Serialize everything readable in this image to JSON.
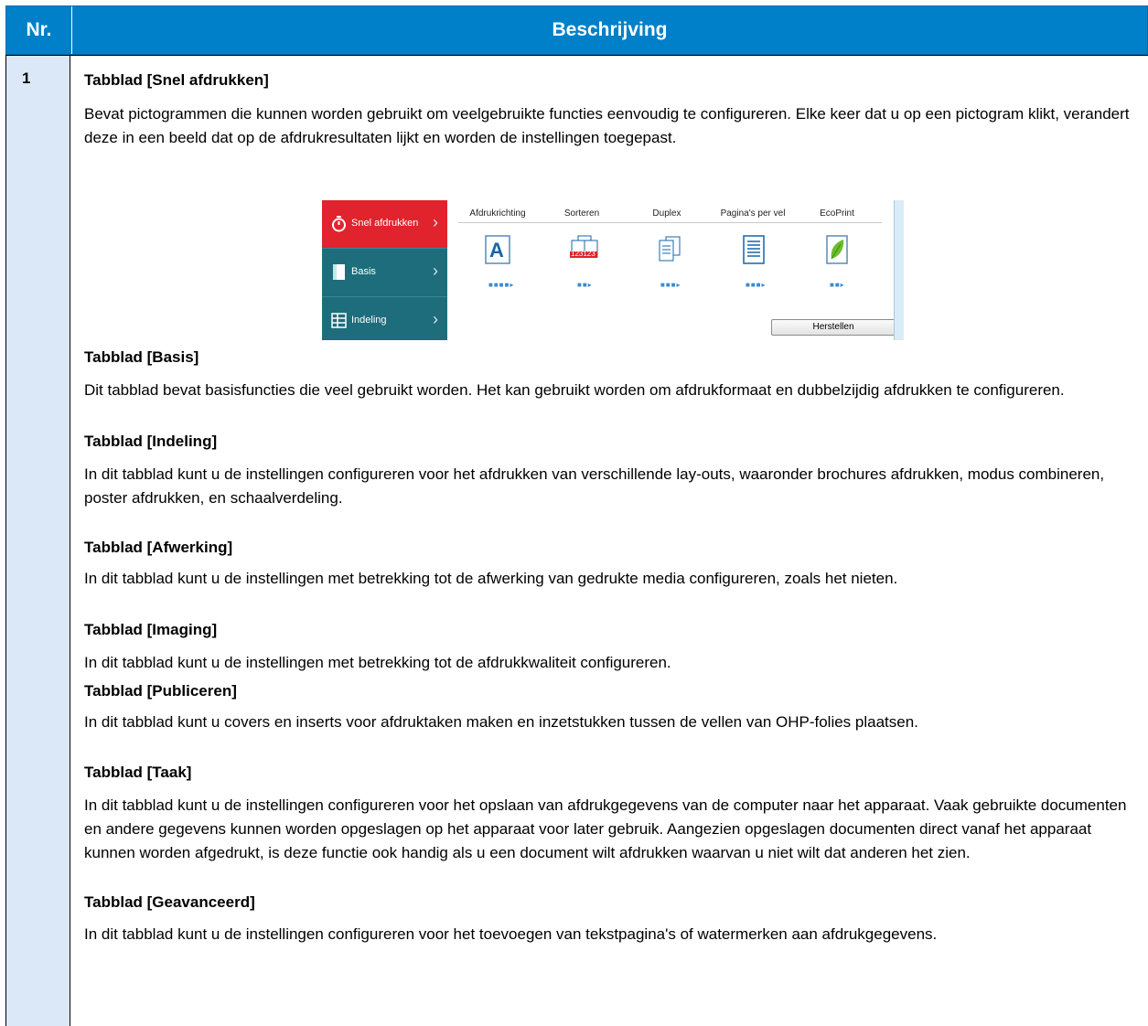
{
  "header": {
    "col1": "Nr.",
    "col2": "Beschrijving"
  },
  "row_number": "1",
  "sections": [
    {
      "title": "Tabblad [Snel afdrukken]",
      "text": "Bevat pictogrammen die kunnen worden gebruikt om veelgebruikte functies eenvoudig te configureren. Elke keer dat u op een pictogram klikt, verandert deze in een beeld dat op de afdrukresultaten lijkt en worden de instellingen toegepast."
    },
    {
      "title": "Tabblad [Basis]",
      "text": "Dit tabblad bevat basisfuncties die veel gebruikt worden. Het kan gebruikt worden om afdrukformaat en dubbelzijdig afdrukken te configureren."
    },
    {
      "title": "Tabblad [Indeling]",
      "text": "In dit tabblad kunt u de instellingen configureren voor het afdrukken van verschillende lay-outs, waaronder brochures afdrukken, modus combineren, poster afdrukken, en schaalverdeling."
    },
    {
      "title": "Tabblad [Afwerking]",
      "text": "In dit tabblad kunt u de instellingen met betrekking tot de afwerking van gedrukte media configureren, zoals het nieten."
    },
    {
      "title": "Tabblad [Imaging]",
      "text": "In dit tabblad kunt u de instellingen met betrekking tot de afdrukkwaliteit configureren."
    },
    {
      "title": "Tabblad [Publiceren]",
      "text": "In dit tabblad kunt u covers en inserts voor afdruktaken maken en inzetstukken tussen de vellen van OHP-folies plaatsen."
    },
    {
      "title": "Tabblad [Taak]",
      "text": "In dit tabblad kunt u de instellingen configureren voor het opslaan van afdrukgegevens van de computer naar het apparaat. Vaak gebruikte documenten en andere gegevens kunnen worden opgeslagen op het apparaat voor later gebruik. Aangezien opgeslagen documenten direct vanaf het apparaat kunnen worden afgedrukt, is deze functie ook handig als u een document wilt afdrukken waarvan u niet wilt dat anderen het zien."
    },
    {
      "title": "Tabblad [Geavanceerd]",
      "text": "In dit tabblad kunt u de instellingen configureren voor het toevoegen van tekstpagina's of watermerken aan afdrukgegevens."
    }
  ],
  "screenshot": {
    "side_tabs": [
      {
        "label": "Snel afdrukken",
        "icon": "stopwatch-icon",
        "active": true
      },
      {
        "label": "Basis",
        "icon": "page-icon",
        "active": false
      },
      {
        "label": "Indeling",
        "icon": "layout-icon",
        "active": false
      }
    ],
    "columns": [
      "Afdrukrichting",
      "Sorteren",
      "Duplex",
      "Pagina's per vel",
      "EcoPrint"
    ],
    "reset_label": "Herstellen",
    "orientation_glyph": "A",
    "collate_numbers": "123123",
    "accent_color": "#e0232c",
    "sidebar_color": "#1e6d7c"
  }
}
